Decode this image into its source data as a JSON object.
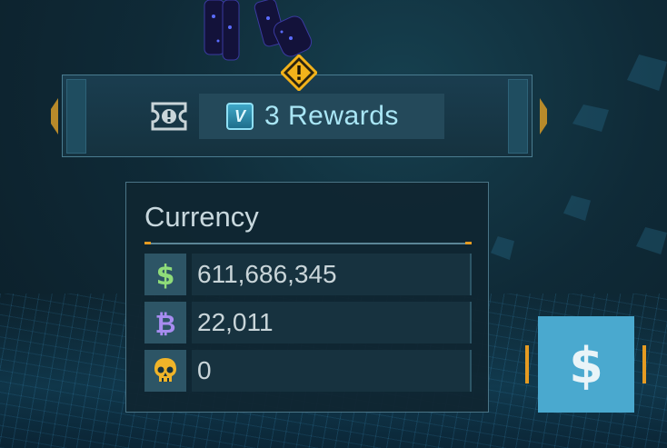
{
  "rewards_banner": {
    "count_label": "3 Rewards",
    "badge_letter": "V",
    "ticket_icon": "ticket-alert-icon",
    "alert_icon": "warning-diamond-icon"
  },
  "currency": {
    "title": "Currency",
    "rows": [
      {
        "icon": "credits-dollar-icon",
        "value": "611,686,345",
        "color": "#8fdc79"
      },
      {
        "icon": "bitcoin-currency-icon",
        "value": "22,011",
        "color": "#a78cf0"
      },
      {
        "icon": "skull-token-icon",
        "value": "0",
        "color": "#f0b429"
      }
    ]
  },
  "shop_button": {
    "icon": "dollar-icon"
  },
  "colors": {
    "accent_cyan": "#4aa9cf",
    "accent_orange": "#e59b22",
    "warning_yellow": "#f2b21b"
  }
}
